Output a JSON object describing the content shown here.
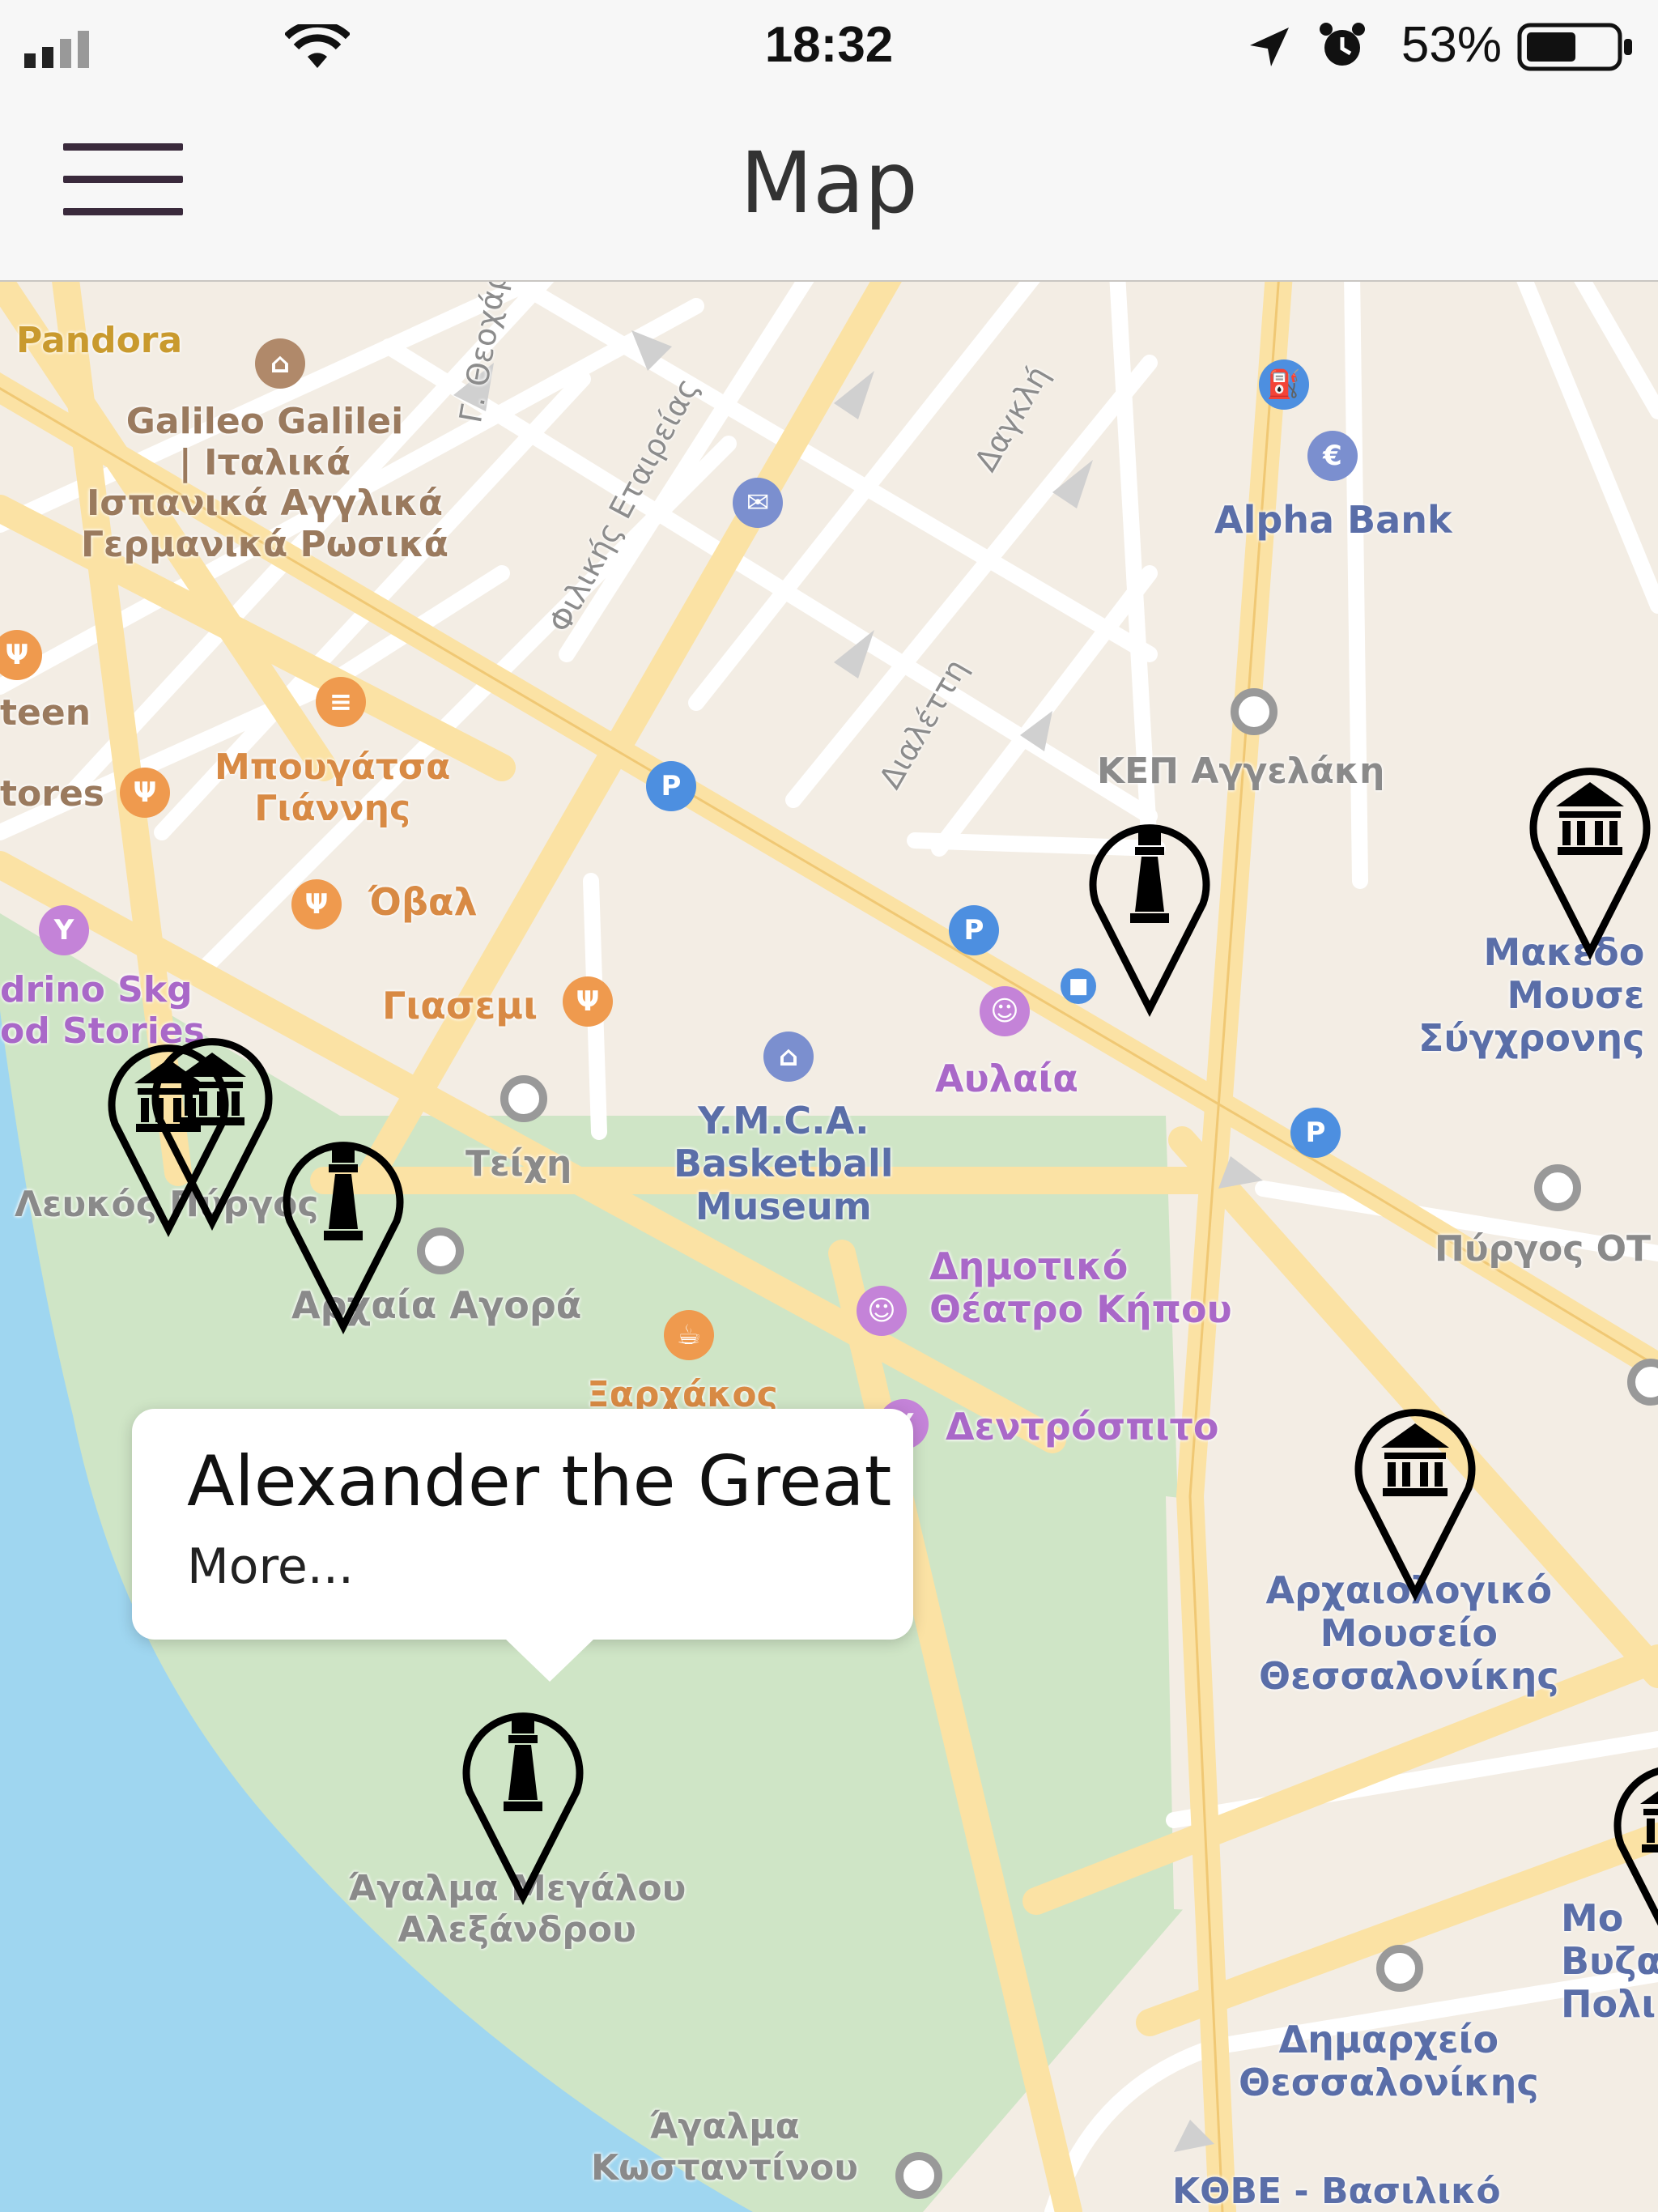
{
  "status_bar": {
    "time": "18:32",
    "battery": "53%"
  },
  "nav": {
    "title": "Map"
  },
  "labels": {
    "pandora": "Pandora",
    "galileo": "Galileo Galilei\n| Ιταλικά\nΙσπανικά Αγγλικά\nΓερμανικά Ρωσικά",
    "canteen": "teen",
    "stores": "tores",
    "bougatsa": "Μπουγάτσα\nΓιάννης",
    "oval": "Όβαλ",
    "sandrino": "drino Skg\nod Stories",
    "giasemi": "Γιασεμι",
    "teichi": "Τείχη",
    "ymca": "Y.M.C.A.\nBasketball\nMuseum",
    "lefkos": "Λευκός Πύργος",
    "archaia_agora": "Αρχαία Αγορά",
    "xarchakos": "Ξαρχάκος",
    "dimotiko": "Δημοτικό\nΘέατρο Κήπου",
    "dentrospito": "Δεντρόσπιτο",
    "aulaia": "Αυλαία",
    "kep": "ΚΕΠ Αγγελάκη",
    "alpha_bank": "Alpha Bank",
    "makedoniko": "Μακεδο\nΜουσε\nΣύγχρονης",
    "pyrgos_ote": "Πύργος ΟΤ",
    "archaiologiko": "Αρχαιολογικό\nΜουσείο\nΘεσσαλονίκης",
    "agalma_megalou": "Άγαλμα Μεγάλου\nΑλεξάνδρου",
    "dimarxeio": "Δημαρχείο\nΘεσσαλονίκης",
    "mo_byz": "Μο\nΒυζα\nΠολι",
    "agalma_kostantinou": "Άγαλμα\nΚωσταντίνου",
    "kvbe": "ΚΘΒΕ - Βασιλικό"
  },
  "streets": {
    "theochari": "Γ. Θεοχάρη",
    "filikis": "Φιλικής Εταιρείας",
    "dagkli": "Δαγκλή",
    "dialetti": "Διαλέττη"
  },
  "callout": {
    "title": "Alexander the Great",
    "more": "More..."
  },
  "markers": [
    {
      "type": "museum-marker"
    },
    {
      "type": "museum-marker"
    },
    {
      "type": "statue-marker"
    },
    {
      "type": "statue-marker"
    },
    {
      "type": "museum-marker"
    },
    {
      "type": "museum-marker"
    },
    {
      "type": "statue-marker"
    },
    {
      "type": "museum-marker"
    }
  ]
}
